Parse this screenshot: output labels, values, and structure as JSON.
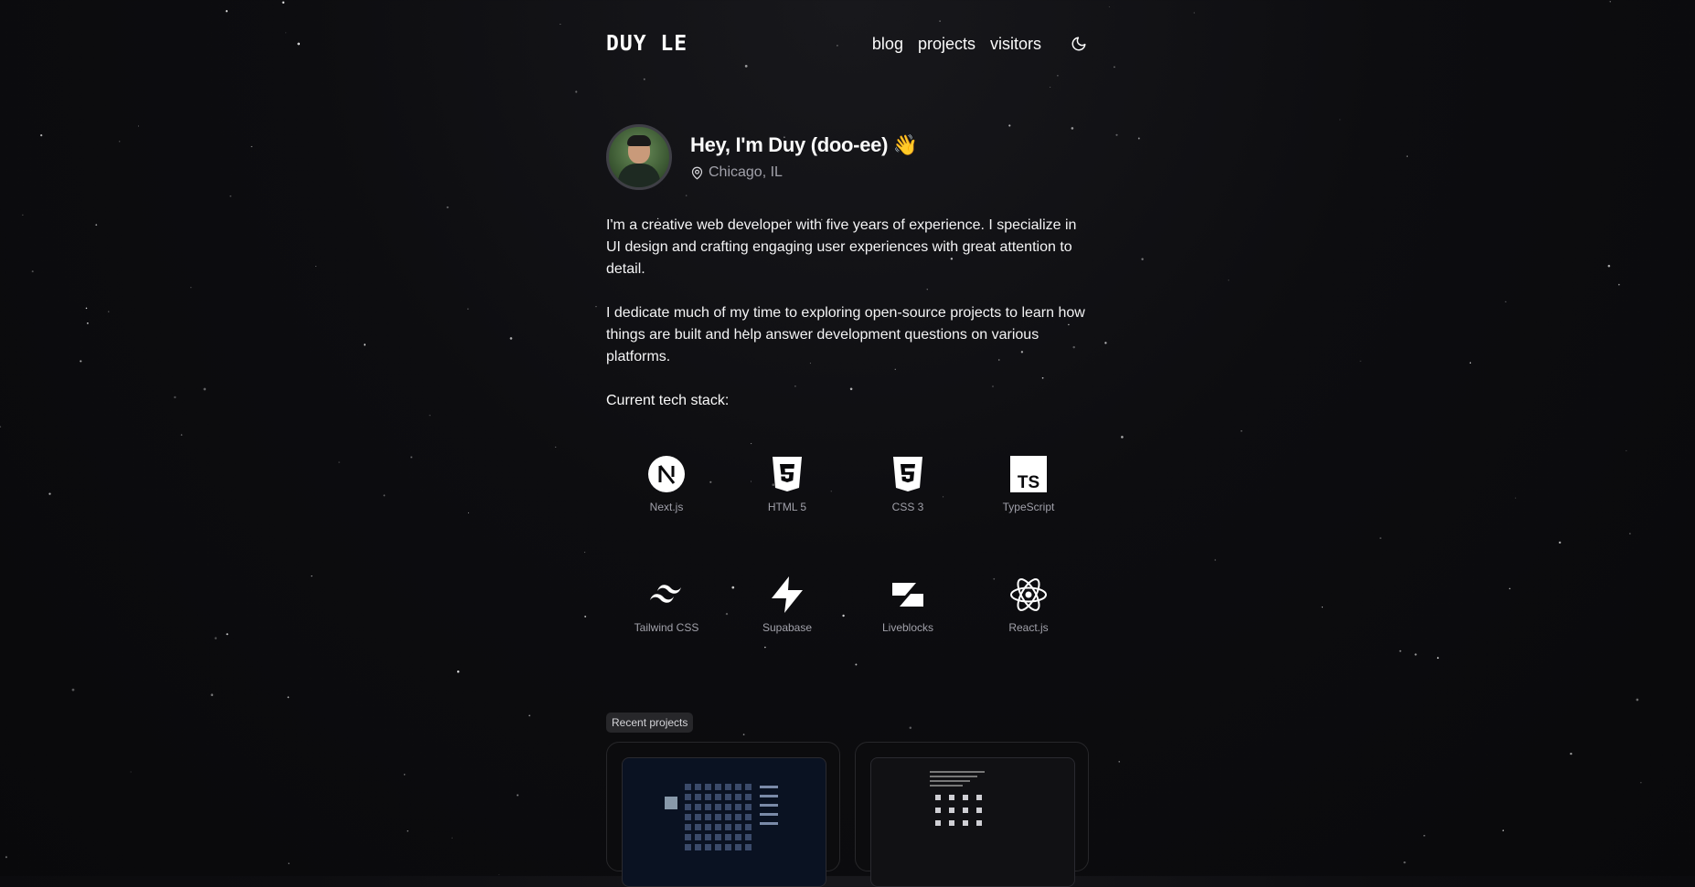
{
  "header": {
    "logo": "DUY LE",
    "nav": [
      {
        "label": "blog"
      },
      {
        "label": "projects"
      },
      {
        "label": "visitors"
      }
    ],
    "theme_toggle_icon": "moon-icon"
  },
  "intro": {
    "greeting": "Hey, I'm Duy (doo-ee) 👋",
    "location": "Chicago, IL",
    "location_icon": "map-pin-icon"
  },
  "bio": {
    "p1": "I'm a creative web developer with five years of experience. I specialize in UI design and crafting engaging user experiences with great attention to detail.",
    "p2": "I dedicate much of my time to exploring open-source projects to learn how things are built and help answer development questions on various platforms.",
    "stack_label": "Current tech stack:"
  },
  "tech_stack": [
    {
      "name": "Next.js",
      "icon": "nextjs-icon"
    },
    {
      "name": "HTML 5",
      "icon": "html5-icon"
    },
    {
      "name": "CSS 3",
      "icon": "css3-icon"
    },
    {
      "name": "TypeScript",
      "icon": "typescript-icon"
    },
    {
      "name": "Tailwind CSS",
      "icon": "tailwind-icon"
    },
    {
      "name": "Supabase",
      "icon": "supabase-icon"
    },
    {
      "name": "Liveblocks",
      "icon": "liveblocks-icon"
    },
    {
      "name": "React.js",
      "icon": "react-icon"
    }
  ],
  "recent_projects": {
    "label": "Recent projects"
  },
  "colors": {
    "background": "#09090b",
    "text": "#fafafa",
    "muted": "#a1a1aa",
    "badge_bg": "#27272a"
  }
}
